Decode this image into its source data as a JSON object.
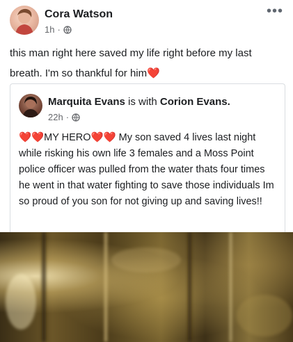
{
  "post": {
    "author": "Cora Watson",
    "time": "1h",
    "separator": "·",
    "more_label": "•••",
    "text": "this man right here saved my life right before my last breath. I'm so thankful for him❤️"
  },
  "shared_post": {
    "author": "Marquita Evans",
    "with_text": "is with",
    "tagged": "Corion Evans.",
    "time": "22h",
    "separator": "·",
    "text_hearts_lead": "❤️❤️",
    "text_hero": "MY HERO",
    "text_hearts_mid": "❤️❤️",
    "text_body": " My son saved 4 lives last night while risking his own life  3 females and a Moss Point police officer was pulled from the water thats four times he went in that water fighting to save those individuals Im so proud of you son for not giving up and saving lives!!"
  },
  "colors": {
    "heart": "#e0245e",
    "meta_gray": "#65676b",
    "text": "#1c1e21"
  },
  "icons": {
    "privacy": "globe-icon",
    "more": "more-options-icon"
  }
}
